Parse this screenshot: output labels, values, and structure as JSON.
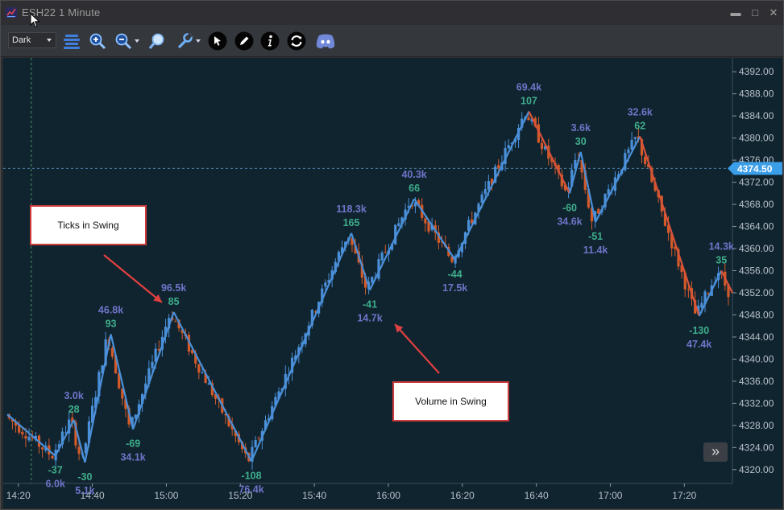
{
  "window": {
    "title": "ESH22 1 Minute",
    "controls": {
      "minimize": "▬",
      "maximize": "□",
      "close": "✕"
    }
  },
  "toolbar": {
    "theme_select": "Dark",
    "tools": [
      "bars-icon",
      "zoom-in-icon",
      "zoom-out-icon",
      "magnifier-icon",
      "wrench-icon",
      "pointer-icon",
      "pencil-icon",
      "info-icon",
      "refresh-icon",
      "discord-icon"
    ]
  },
  "colors": {
    "background": "#10242f",
    "up_candle": "#4a8fd8",
    "down_candle": "#d35a2a",
    "swing_up": "#4a8fd8",
    "swing_down": "#d9523a",
    "volume_label": "#6f74c8",
    "ticks_label": "#3fae8c",
    "price_tag": "#3b9ee8"
  },
  "chart_data": {
    "type": "candlestick",
    "instrument": "ESH22",
    "timeframe": "1 Minute",
    "current_price": "4374.50",
    "y_ticks": [
      "4392.00",
      "4388.00",
      "4384.00",
      "4380.00",
      "4376.00",
      "4372.00",
      "4368.00",
      "4364.00",
      "4360.00",
      "4356.00",
      "4352.00",
      "4348.00",
      "4344.00",
      "4340.00",
      "4336.00",
      "4332.00",
      "4328.00",
      "4324.00",
      "4320.00"
    ],
    "y_values": [
      4392,
      4388,
      4384,
      4380,
      4376,
      4372,
      4368,
      4364,
      4360,
      4356,
      4352,
      4348,
      4344,
      4340,
      4336,
      4332,
      4328,
      4324,
      4320
    ],
    "ylim": [
      4317.5,
      4394.5
    ],
    "x_ticks": [
      "14:20",
      "14:40",
      "15:00",
      "15:20",
      "15:40",
      "16:00",
      "16:20",
      "16:40",
      "17:00",
      "17:20"
    ],
    "x_minutes": [
      0,
      20,
      40,
      60,
      80,
      100,
      120,
      140,
      160,
      180
    ],
    "xlim": [
      -3,
      193
    ],
    "swings": [
      {
        "t": -3,
        "p": 4330.0
      },
      {
        "t": 10,
        "p": 4322.5,
        "ticks": "-37",
        "volume": "6.0k",
        "dir": "low"
      },
      {
        "t": 15,
        "p": 4329.0,
        "ticks": "28",
        "volume": "3.0k",
        "dir": "high"
      },
      {
        "t": 18,
        "p": 4321.3,
        "ticks": "-30",
        "volume": "5.1k",
        "dir": "low"
      },
      {
        "t": 25,
        "p": 4344.5,
        "ticks": "93",
        "volume": "46.8k",
        "dir": "high"
      },
      {
        "t": 31,
        "p": 4327.3,
        "ticks": "-69",
        "volume": "34.1k",
        "dir": "low"
      },
      {
        "t": 42,
        "p": 4348.5,
        "ticks": "85",
        "volume": "96.5k",
        "dir": "high"
      },
      {
        "t": 63,
        "p": 4321.5,
        "ticks": "-108",
        "volume": "76.4k",
        "dir": "low"
      },
      {
        "t": 90,
        "p": 4362.8,
        "ticks": "165",
        "volume": "118.3k",
        "dir": "high"
      },
      {
        "t": 95,
        "p": 4352.5,
        "ticks": "-41",
        "volume": "14.7k",
        "dir": "low"
      },
      {
        "t": 107,
        "p": 4369.0,
        "ticks": "66",
        "volume": "40.3k",
        "dir": "high"
      },
      {
        "t": 118,
        "p": 4358.0,
        "ticks": "-44",
        "volume": "17.5k",
        "dir": "low"
      },
      {
        "t": 138,
        "p": 4384.8,
        "ticks": "107",
        "volume": "69.4k",
        "dir": "high"
      },
      {
        "t": 149,
        "p": 4370.0,
        "ticks": "-60",
        "volume": "34.6k",
        "dir": "low"
      },
      {
        "t": 152,
        "p": 4377.5,
        "ticks": "30",
        "volume": "3.6k",
        "dir": "high"
      },
      {
        "t": 156,
        "p": 4364.8,
        "ticks": "-51",
        "volume": "11.4k",
        "dir": "low"
      },
      {
        "t": 168,
        "p": 4380.3,
        "ticks": "62",
        "volume": "32.6k",
        "dir": "high"
      },
      {
        "t": 184,
        "p": 4347.8,
        "ticks": "-130",
        "volume": "47.4k",
        "dir": "low"
      },
      {
        "t": 190,
        "p": 4356.0,
        "ticks": "35",
        "volume": "14.3k",
        "dir": "high"
      },
      {
        "t": 193,
        "p": 4352.0
      }
    ]
  },
  "annotations": {
    "ticks_callout": "Ticks in Swing",
    "volume_callout": "Volume in Swing"
  },
  "expand_button": "»"
}
